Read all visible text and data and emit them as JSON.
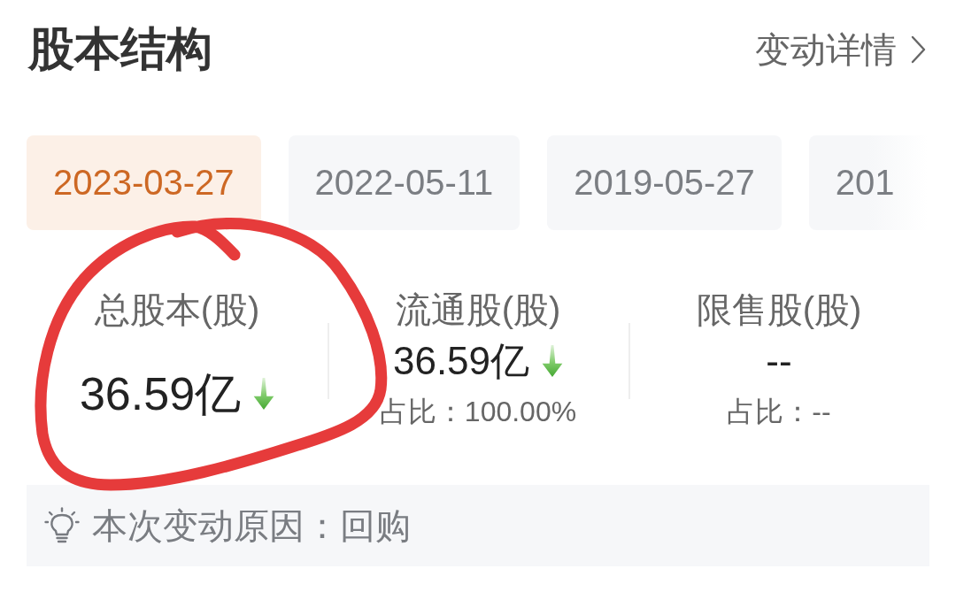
{
  "header": {
    "title": "股本结构",
    "link": {
      "label": "变动详情"
    }
  },
  "dates": [
    {
      "label": "2023-03-27",
      "selected": true
    },
    {
      "label": "2022-05-11",
      "selected": false
    },
    {
      "label": "2019-05-27",
      "selected": false
    },
    {
      "label": "201",
      "selected": false
    }
  ],
  "stats": [
    {
      "kind": "total",
      "label": "总股本(股)",
      "value": "36.59亿",
      "falling": true
    },
    {
      "kind": "split",
      "label": "流通股(股)",
      "value": "36.59亿",
      "falling": true,
      "share": "占比：100.00%"
    },
    {
      "kind": "split",
      "label": "限售股(股)",
      "value": "--",
      "share": "占比：--"
    }
  ],
  "reason": {
    "label": "本次变动原因：",
    "value": "回购"
  },
  "annotation": {
    "kind": "circle"
  }
}
